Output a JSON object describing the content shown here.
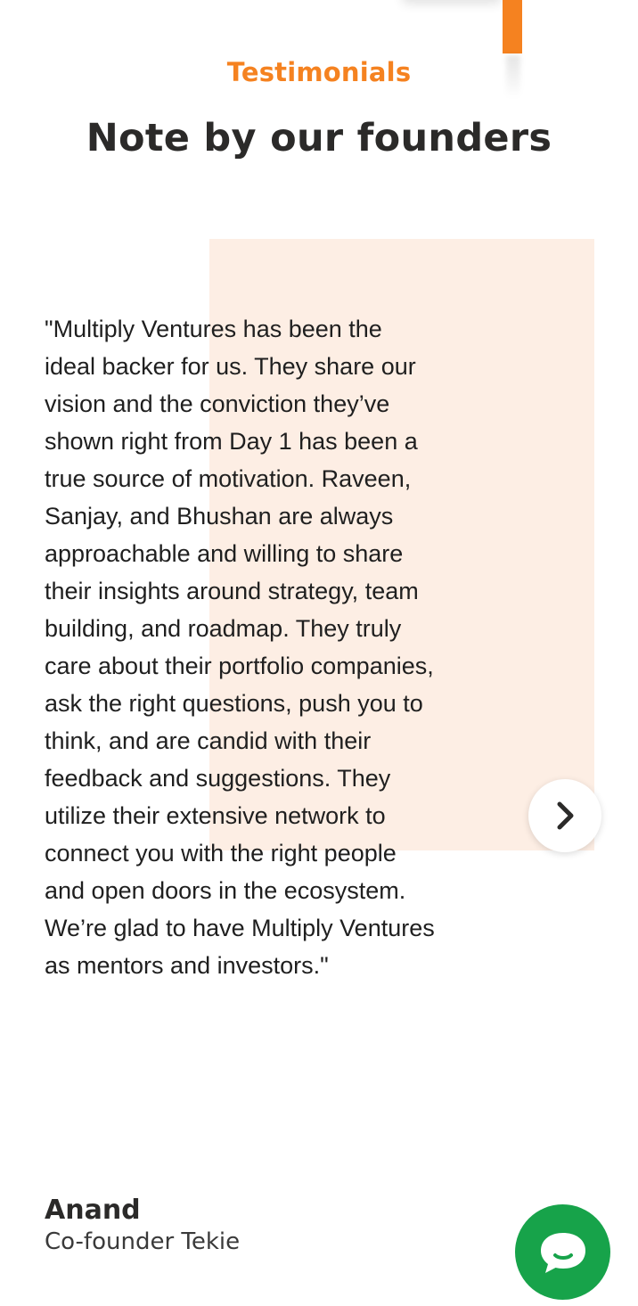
{
  "section": {
    "eyebrow": "Testimonials",
    "heading": "Note by our founders"
  },
  "testimonial": {
    "quote": "\"Multiply Ventures has been the ideal backer for us. They share our vision and the conviction they’ve shown right from Day 1 has been a true source of motivation. Raveen, Sanjay, and Bhushan are always approachable and willing to share their insights around strategy, team building, and roadmap. They truly care about their portfolio companies, ask the right questions, push you to think, and are candid with their feedback and suggestions. They utilize their extensive network to connect you with the right people and open doors in the ecosystem. We’re glad to have Multiply Ventures as mentors and investors.\"",
    "author_name": "Anand",
    "author_role": "Co-founder Tekie"
  },
  "controls": {
    "next_icon": "chevron-right-icon",
    "chat_icon": "chat-bubble-icon"
  },
  "colors": {
    "accent": "#f58220",
    "heading": "#2b2a29",
    "panel": "#fdeee4",
    "chat": "#17a34a"
  }
}
